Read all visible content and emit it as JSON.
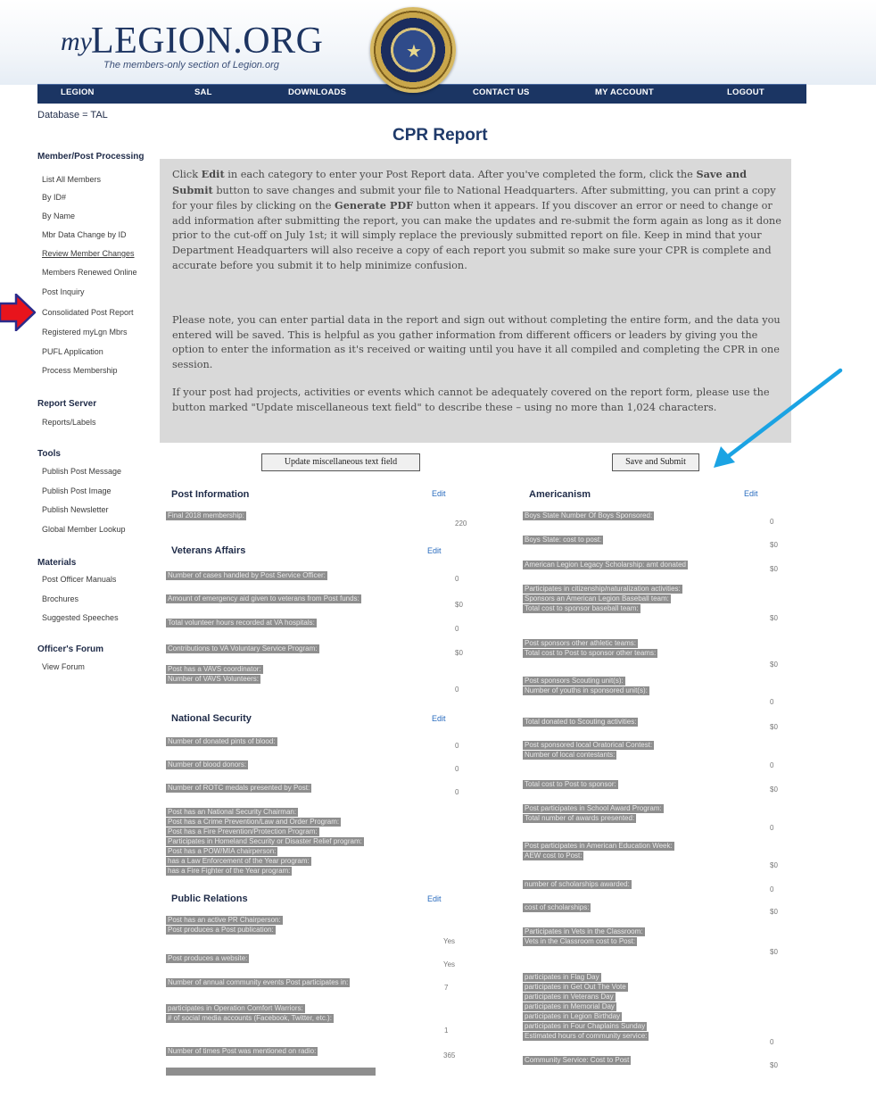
{
  "header": {
    "logo_my": "my",
    "logo_main": "LEGION.ORG",
    "tagline": "The members-only section of Legion.org"
  },
  "nav": [
    "LEGION",
    "SAL",
    "DOWNLOADS",
    "CONTACT US",
    "MY ACCOUNT",
    "LOGOUT"
  ],
  "sidebar": {
    "database": "Database = TAL",
    "sections": [
      {
        "title": "Member/Post Processing",
        "items": [
          "List All Members",
          "By ID#",
          "By Name",
          "Mbr Data Change by ID",
          "Review Member Changes",
          "Members Renewed Online",
          "Post Inquiry",
          "Consolidated Post Report",
          "Registered myLgn Mbrs",
          "PUFL Application",
          "Process Membership"
        ]
      },
      {
        "title": "Report Server",
        "items": [
          "Reports/Labels"
        ]
      },
      {
        "title": "Tools",
        "items": [
          "Publish Post Message",
          "Publish Post Image",
          "Publish Newsletter",
          "Global Member Lookup"
        ]
      },
      {
        "title": "Materials",
        "items": [
          "Post Officer Manuals",
          "Brochures",
          "Suggested Speeches"
        ]
      },
      {
        "title": "Officer's Forum",
        "items": [
          "View Forum"
        ]
      }
    ]
  },
  "main": {
    "title": "CPR Report",
    "info": {
      "p1a": "Click ",
      "p1b": "Edit",
      "p1c": " in each category to enter your Post Report data.  After you've completed the form, click the ",
      "p1d": "Save and Submit",
      "p1e": " button to save changes and submit your file to National Headquarters. After submitting, you can print a copy for your files by clicking on the ",
      "p1f": "Generate PDF",
      "p1g": " button when it appears.  If you discover an error or need to change or add information after submitting the report, you can make the updates and re-submit the form again as long as it done prior to the cut-off on July 1st; it will simply replace the previously submitted report on file. Keep in mind that your Department Headquarters will also receive a copy of each report you submit so make sure your CPR is complete and accurate before you submit it to help minimize confusion.",
      "p2": "Please note, you can enter partial data in the report and sign out without completing the entire form, and the data you entered will be saved. This is helpful as you gather information from different officers or leaders by giving you the option to enter the information as it's received or waiting until you have it all compiled and completing the CPR in one session.",
      "p3": "If your post had projects, activities or events which cannot be adequately covered on the report form, please use the button marked \"Update miscellaneous text field\" to describe these – using no more than 1,024 characters."
    },
    "buttons": {
      "misc": "Update miscellaneous text field",
      "save": "Save and Submit"
    },
    "edit_label": "Edit",
    "left_sections": [
      {
        "title": "Post Information",
        "rows": [
          {
            "labels": [
              "Final 2018 membership:"
            ],
            "value": "220"
          }
        ]
      },
      {
        "title": "Veterans Affairs",
        "rows": [
          {
            "labels": [
              "Number of cases handled by Post Service Officer:"
            ],
            "value": "0"
          },
          {
            "labels": [
              "Amount of emergency aid given to veterans from Post funds:"
            ],
            "value": "$0"
          },
          {
            "labels": [
              "Total volunteer hours recorded at VA hospitals:"
            ],
            "value": "0"
          },
          {
            "labels": [
              "Contributions to VA Voluntary Service Program:"
            ],
            "value": "$0"
          },
          {
            "labels": [
              "Post has a VAVS coordinator:",
              "Number of VAVS Volunteers:"
            ],
            "value": "0"
          }
        ]
      },
      {
        "title": "National Security",
        "rows": [
          {
            "labels": [
              "Number of donated pints of blood:"
            ],
            "value": "0"
          },
          {
            "labels": [
              "Number of blood donors:"
            ],
            "value": "0"
          },
          {
            "labels": [
              "Number of ROTC medals presented by Post:"
            ],
            "value": "0"
          },
          {
            "labels": [
              "Post has an National Security Chairman:",
              "Post has a Crime Prevention/Law and Order Program:",
              "Post has a Fire Prevention/Protection Program:",
              "Participates in Homeland Security or Disaster Relief program:",
              "Post has a POW/MIA chairperson:",
              "has a Law Enforcement of the Year program:",
              "has a Fire Fighter of the Year program:"
            ],
            "value": ""
          }
        ]
      },
      {
        "title": "Public Relations",
        "rows": [
          {
            "labels": [
              "Post has an active PR Chairperson:",
              "Post produces a Post publication:"
            ],
            "value": "Yes"
          },
          {
            "labels": [
              "Post produces a website:"
            ],
            "value": "Yes"
          },
          {
            "labels": [
              "Number of annual community events Post participates in:"
            ],
            "value": "7"
          },
          {
            "labels": [
              "participates in Operation Comfort Warriors:",
              "# of social media accounts (Facebook, Twitter, etc.):"
            ],
            "value": "1"
          },
          {
            "labels": [
              "Number of times Post was mentioned on radio:"
            ],
            "value": "365"
          }
        ]
      }
    ],
    "right_section": {
      "title": "Americanism",
      "rows": [
        {
          "labels": [
            "Boys State Number Of Boys Sponsored:"
          ],
          "value": "0"
        },
        {
          "labels": [
            "Boys State: cost to post:"
          ],
          "value": "$0"
        },
        {
          "labels": [
            "American Legion Legacy Scholarship: amt donated"
          ],
          "value": "$0"
        },
        {
          "labels": [
            "Participates in citizenship/naturalization activities:",
            "Sponsors an American Legion Baseball team:",
            "Total cost to sponsor baseball team:"
          ],
          "value": "$0"
        },
        {
          "labels": [
            "Post sponsors other athletic teams:",
            "Total cost to Post to sponsor other teams:"
          ],
          "value": "$0"
        },
        {
          "labels": [
            "Post sponsors Scouting unit(s):",
            "Number of youths in sponsored unit(s):"
          ],
          "value": "0"
        },
        {
          "labels": [
            "Total donated to Scouting activities:"
          ],
          "value": "$0"
        },
        {
          "labels": [
            "Post sponsored local Oratorical Contest:",
            "Number of local contestants:"
          ],
          "value": "0"
        },
        {
          "labels": [
            "Total cost to Post to sponsor:"
          ],
          "value": "$0"
        },
        {
          "labels": [
            "Post participates in School Award Program:",
            "Total number of awards presented:"
          ],
          "value": "0"
        },
        {
          "labels": [
            "Post participates in American Education Week:",
            "AEW cost to Post:"
          ],
          "value": "$0"
        },
        {
          "labels": [
            "number of scholarships awarded:"
          ],
          "value": "0"
        },
        {
          "labels": [
            "cost of scholarships:"
          ],
          "value": "$0"
        },
        {
          "labels": [
            "Participates in Vets in the Classroom:",
            "Vets in the Classroom cost to Post:"
          ],
          "value": "$0"
        },
        {
          "labels": [
            "participates in Flag Day",
            "participates in Get Out The Vote",
            "participates in Veterans Day",
            "participates in Memorial Day",
            "participates in Legion Birthday",
            "participates in Four Chaplains Sunday",
            "Estimated hours of community service:"
          ],
          "value": "0"
        },
        {
          "labels": [
            "Community Service: Cost to Post"
          ],
          "value": "$0"
        }
      ]
    }
  }
}
